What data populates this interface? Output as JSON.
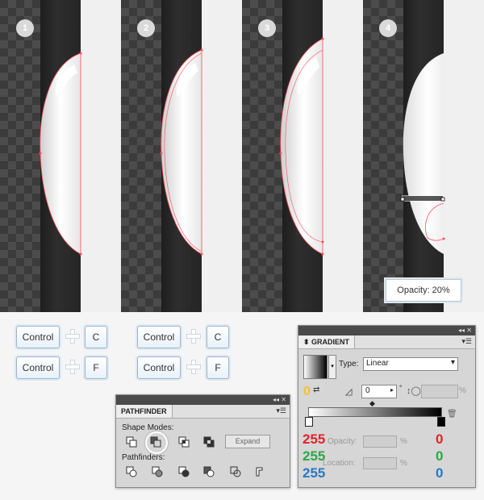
{
  "steps": [
    "1",
    "2",
    "3",
    "4"
  ],
  "tooltip": "Opacity: 20%",
  "keys": {
    "row1_left": [
      "Control",
      "C"
    ],
    "row2_left": [
      "Control",
      "F"
    ],
    "row1_right": [
      "Control",
      "C"
    ],
    "row2_right": [
      "Control",
      "F"
    ]
  },
  "pathfinder": {
    "title": "PATHFINDER",
    "shape_modes_label": "Shape Modes:",
    "expand_label": "Expand",
    "pathfinders_label": "Pathfinders:"
  },
  "gradient": {
    "title": "GRADIENT",
    "type_label": "Type:",
    "type_value": "Linear",
    "angle_value": "0",
    "aspect_unit": "%",
    "opacity_label": "Opacity:",
    "location_label": "Location:",
    "percent": "%",
    "rgb_left": {
      "r": "255",
      "g": "255",
      "b": "255"
    },
    "rgb_right": {
      "r": "0",
      "g": "0",
      "b": "0"
    },
    "reverse_value": "0"
  },
  "colors": {
    "red": "#e0242c",
    "green": "#2ca84a",
    "blue": "#2a78c4",
    "yellow": "#f5c22c",
    "anchor": "#ff4d5a"
  }
}
